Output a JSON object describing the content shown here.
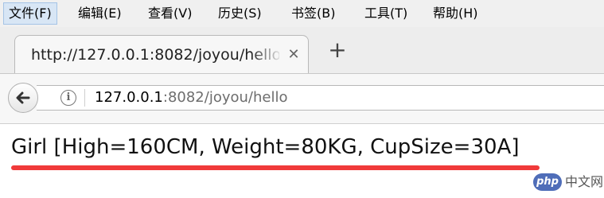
{
  "menubar": {
    "items": [
      {
        "label": "文件(F)"
      },
      {
        "label": "编辑(E)"
      },
      {
        "label": "查看(V)"
      },
      {
        "label": "历史(S)"
      },
      {
        "label": "书签(B)"
      },
      {
        "label": "工具(T)"
      },
      {
        "label": "帮助(H)"
      }
    ]
  },
  "tab": {
    "title": "http://127.0.0.1:8082/joyou/hello",
    "close_symbol": "✕",
    "new_tab_symbol": "+"
  },
  "navbar": {
    "back_icon": "back-arrow-icon",
    "info_icon": "i",
    "url_host": "127.0.0.1",
    "url_rest": ":8082/joyou/hello"
  },
  "page": {
    "response_text": "Girl [High=160CM, Weight=80KG, CupSize=30A]",
    "underline_color": "#f03a3a"
  },
  "watermark": {
    "badge": "php",
    "text": "中文网"
  }
}
